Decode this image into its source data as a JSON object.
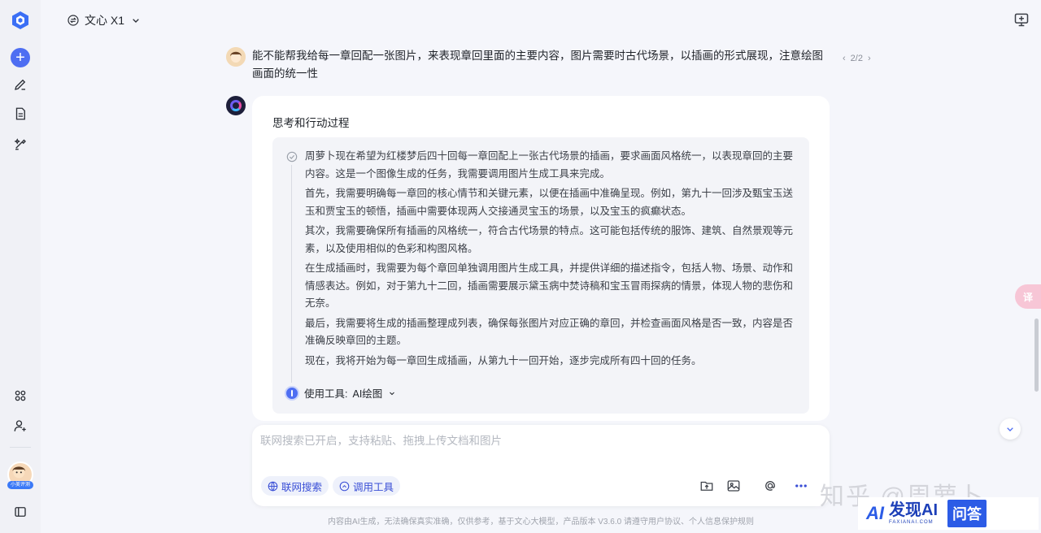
{
  "header": {
    "model_name": "文心 X1"
  },
  "conversation": {
    "user_message": "能不能帮我给每一章回配一张图片，来表现章回里面的主要内容，图片需要时古代场景，以插画的形式展现，注意绘图画面的统一性",
    "pager": "2/2",
    "thinking_title": "思考和行动过程",
    "thinking_paragraphs": [
      "周萝卜现在希望为红楼梦后四十回每一章回配上一张古代场景的插画，要求画面风格统一，以表现章回的主要内容。这是一个图像生成的任务，我需要调用图片生成工具来完成。",
      "首先，我需要明确每一章回的核心情节和关键元素，以便在插画中准确呈现。例如，第九十一回涉及甄宝玉送玉和贾宝玉的顿悟，插画中需要体现两人交接通灵宝玉的场景，以及宝玉的疯癫状态。",
      "其次，我需要确保所有插画的风格统一，符合古代场景的特点。这可能包括传统的服饰、建筑、自然景观等元素，以及使用相似的色彩和构图风格。",
      "在生成插画时，我需要为每个章回单独调用图片生成工具，并提供详细的描述指令，包括人物、场景、动作和情感表达。例如，对于第九十二回，插画需要展示黛玉病中焚诗稿和宝玉冒雨探病的情景，体现人物的悲伤和无奈。",
      "最后，我需要将生成的插画整理成列表，确保每张图片对应正确的章回，并检查画面风格是否一致，内容是否准确反映章回的主题。",
      "现在，我将开始为每一章回生成插画，从第九十一回开始，逐步完成所有四十回的任务。"
    ],
    "tool_label": "使用工具:",
    "tool_name": "AI绘图"
  },
  "input": {
    "placeholder": "联网搜索已开启，支持粘贴、拖拽上传文档和图片",
    "chip_search": "联网搜索",
    "chip_tools": "调用工具"
  },
  "footer": {
    "disclaimer": "内容由AI生成，无法确保真实准确，仅供参考，基于文心大模型，产品版本 V3.6.0 请遵守用户协议、个人信息保护规则"
  },
  "sidebar": {
    "user_badge": "小美评测"
  },
  "overlay": {
    "translate_label": "译",
    "watermark": "知乎 @周萝卜",
    "brand_mark": "AI",
    "brand_name": "发现AI",
    "brand_domain": "FAXIANAI.COM",
    "brand_qa": "问答"
  },
  "colors": {
    "accent": "#4e6ef2",
    "chip_text": "#3a4fd6",
    "background": "#f5f6fb"
  }
}
